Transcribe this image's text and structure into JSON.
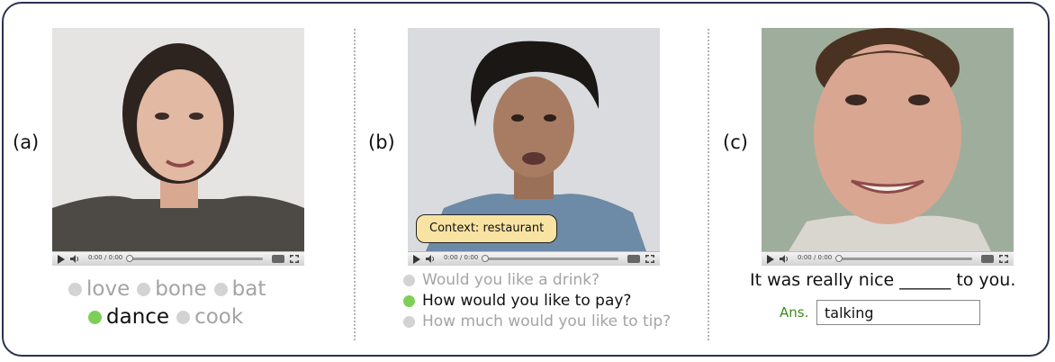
{
  "panels": {
    "a": {
      "label": "(a)",
      "video_time": "0:00 / 0:00",
      "options": [
        {
          "text": "love",
          "selected": false
        },
        {
          "text": "bone",
          "selected": false
        },
        {
          "text": "bat",
          "selected": false
        },
        {
          "text": "dance",
          "selected": true
        },
        {
          "text": "cook",
          "selected": false
        }
      ]
    },
    "b": {
      "label": "(b)",
      "video_time": "0:00 / 0:00",
      "context": "Context: restaurant",
      "options": [
        {
          "text": "Would you like a drink?",
          "selected": false
        },
        {
          "text": "How would you like to pay?",
          "selected": true
        },
        {
          "text": "How much would you like to tip?",
          "selected": false
        }
      ]
    },
    "c": {
      "label": "(c)",
      "video_time": "0:00 / 0:00",
      "sentence": "It was really nice ______ to you.",
      "answer_label": "Ans.",
      "answer_value": "talking"
    }
  },
  "colors": {
    "border": "#2b3250",
    "selected_dot": "#7dcf57",
    "unselected_dot": "#d3d3d3",
    "answer_label": "#3e8a1f",
    "context_bubble": "#f9e3a3"
  },
  "icons": [
    "play-icon",
    "volume-icon",
    "quality-icon",
    "fullscreen-icon"
  ]
}
